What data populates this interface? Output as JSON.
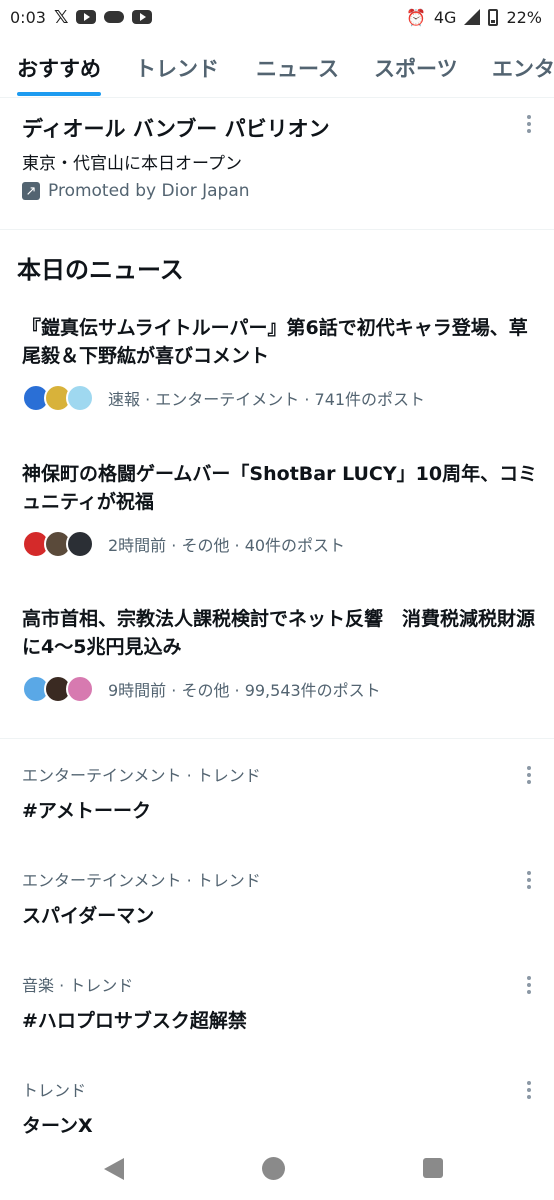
{
  "status_bar": {
    "time": "0:03",
    "network": "4G",
    "battery": "22%",
    "icons": [
      "x-icon",
      "youtube-icon",
      "cloud-icon",
      "youtube-icon",
      "alarm-icon",
      "signal-icon",
      "battery-icon"
    ]
  },
  "tabs": [
    {
      "label": "おすすめ",
      "active": true
    },
    {
      "label": "トレンド",
      "active": false
    },
    {
      "label": "ニュース",
      "active": false
    },
    {
      "label": "スポーツ",
      "active": false
    },
    {
      "label": "エンタ",
      "active": false
    }
  ],
  "promoted": {
    "title": "ディオール バンブー パビリオン",
    "subtitle": "東京・代官山に本日オープン",
    "badge": "Promoted by Dior Japan"
  },
  "news": {
    "header": "本日のニュース",
    "items": [
      {
        "title": "『鎧真伝サムライトルーパー』第6話で初代キャラ登場、草尾毅＆下野紘が喜びコメント",
        "meta": "速報 · エンターテイメント · 741件のポスト",
        "avatar_colors": [
          "#2a6fd6",
          "#d8b23a",
          "#9fd8f0"
        ]
      },
      {
        "title": "神保町の格闘ゲームバー「ShotBar LUCY」10周年、コミュニティが祝福",
        "meta": "2時間前 · その他 · 40件のポスト",
        "avatar_colors": [
          "#d42a2a",
          "#5a4a3a",
          "#2b2f35"
        ]
      },
      {
        "title": "高市首相、宗教法人課税検討でネット反響　消費税減税財源に4〜5兆円見込み",
        "meta": "9時間前 · その他 · 99,543件のポスト",
        "avatar_colors": [
          "#5aa8e6",
          "#3a2a22",
          "#d77ab0"
        ]
      }
    ]
  },
  "trends": [
    {
      "category": "エンターテインメント · トレンド",
      "name": "#アメトーーク"
    },
    {
      "category": "エンターテインメント · トレンド",
      "name": "スパイダーマン"
    },
    {
      "category": "音楽 · トレンド",
      "name": "#ハロプロサブスク超解禁"
    },
    {
      "category": "トレンド",
      "name": "ターンX"
    }
  ],
  "colors": {
    "accent": "#1d9bf0",
    "secondary_text": "#536471"
  }
}
